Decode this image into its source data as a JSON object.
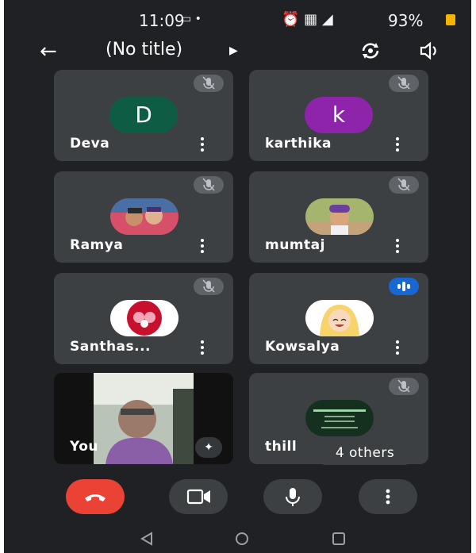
{
  "status_bar": {
    "time": "11:09",
    "battery": "93%"
  },
  "header": {
    "title": "(No title)"
  },
  "participants": [
    {
      "name": "Deva",
      "initial": "D",
      "avatar_color": "#0f5c45",
      "muted": true
    },
    {
      "name": "karthika",
      "initial": "k",
      "avatar_color": "#8e24aa",
      "muted": true
    },
    {
      "name": "Ramya",
      "muted": true
    },
    {
      "name": "mumtaj",
      "muted": true
    },
    {
      "name": "Santhas...",
      "muted": true
    },
    {
      "name": "Kowsalya",
      "muted": false,
      "speaking": true
    },
    {
      "name": "You"
    },
    {
      "name": "thill",
      "muted": true
    }
  ],
  "others_label": "4 others",
  "colors": {
    "background": "#202124",
    "tile": "#3c4043",
    "end_call": "#ea4335",
    "speaking": "#1967d2"
  }
}
